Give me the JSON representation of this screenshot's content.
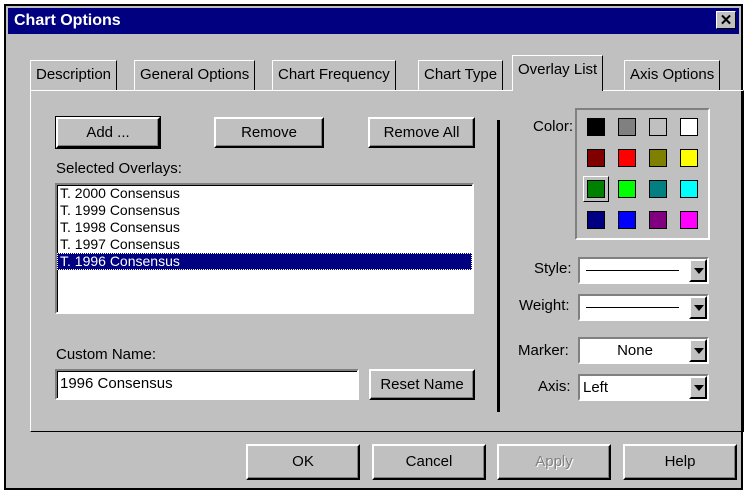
{
  "window": {
    "title": "Chart Options",
    "close_glyph": "✕"
  },
  "tabs": [
    {
      "label": "Description"
    },
    {
      "label": "General Options"
    },
    {
      "label": "Chart Frequency"
    },
    {
      "label": "Chart Type"
    },
    {
      "label": "Overlay List",
      "active": true
    },
    {
      "label": "Axis Options"
    }
  ],
  "overlay_panel": {
    "add_label": "Add ...",
    "remove_label": "Remove",
    "remove_all_label": "Remove All",
    "selected_overlays_label": "Selected Overlays:",
    "overlays": [
      "T. 2000 Consensus",
      "T. 1999 Consensus",
      "T. 1998 Consensus",
      "T. 1997 Consensus",
      "T. 1996 Consensus"
    ],
    "selected_overlay": "T. 1996 Consensus",
    "custom_name_label": "Custom Name:",
    "custom_name_value": "1996 Consensus",
    "reset_name_label": "Reset Name"
  },
  "appearance": {
    "color_label": "Color:",
    "colors": [
      "#000000",
      "#808080",
      "#c0c0c0",
      "#ffffff",
      "#800000",
      "#ff0000",
      "#808000",
      "#ffff00",
      "#008000",
      "#00ff00",
      "#008080",
      "#00ffff",
      "#000080",
      "#0000ff",
      "#800080",
      "#ff00ff"
    ],
    "selected_color": "#008000",
    "style_label": "Style:",
    "style_value": "solid",
    "weight_label": "Weight:",
    "weight_value": "thin",
    "marker_label": "Marker:",
    "marker_value": "None",
    "axis_label": "Axis:",
    "axis_value": "Left"
  },
  "footer": {
    "ok_label": "OK",
    "cancel_label": "Cancel",
    "apply_label": "Apply",
    "help_label": "Help"
  },
  "colors": {
    "title_bar": "#000080",
    "dialog_face": "#c0c0c0",
    "selection": "#000080"
  }
}
